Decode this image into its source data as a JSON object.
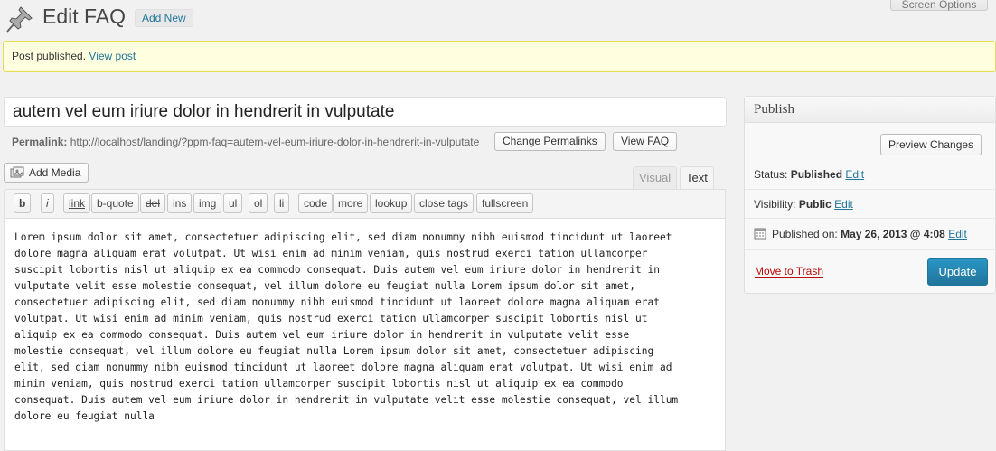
{
  "screen_options_label": "Screen Options",
  "header": {
    "title": "Edit FAQ",
    "add_new_label": "Add New"
  },
  "notice": {
    "text": "Post published.",
    "link": "View post"
  },
  "post": {
    "title": "autem vel eum iriure dolor in hendrerit in vulputate",
    "permalink_label": "Permalink:",
    "permalink_url": "http://localhost/landing/?ppm-faq=autem-vel-eum-iriure-dolor-in-hendrerit-in-vulputate",
    "change_permalinks_label": "Change Permalinks",
    "view_faq_label": "View FAQ"
  },
  "editor": {
    "add_media_label": "Add Media",
    "tabs": [
      "Visual",
      "Text"
    ],
    "active_tab": "Text",
    "quicktags": [
      "b",
      "i",
      "link",
      "b-quote",
      "del",
      "ins",
      "img",
      "ul",
      "ol",
      "li",
      "code",
      "more",
      "lookup",
      "close tags",
      "fullscreen"
    ],
    "lines": [
      "Lorem ipsum dolor sit amet, consectetuer adipiscing elit, sed diam nonummy nibh euismod tincidunt ut laoreet",
      "dolore magna aliquam erat volutpat. Ut wisi enim ad minim veniam, quis nostrud exerci tation ullamcorper",
      "suscipit lobortis nisl ut aliquip ex ea commodo consequat. Duis autem vel eum iriure dolor in hendrerit in",
      "vulputate velit esse molestie consequat, vel illum dolore eu feugiat nulla Lorem ipsum dolor sit amet,",
      "consectetuer adipiscing elit, sed diam nonummy nibh euismod tincidunt ut laoreet dolore magna aliquam erat",
      "volutpat. Ut wisi enim ad minim veniam, quis nostrud exerci tation ullamcorper suscipit lobortis nisl ut",
      "aliquip ex ea commodo consequat. Duis autem vel eum iriure dolor in hendrerit in vulputate velit esse",
      "molestie consequat, vel illum dolore eu feugiat nulla Lorem ipsum dolor sit amet, consectetuer adipiscing",
      "elit, sed diam nonummy nibh euismod tincidunt ut laoreet dolore magna aliquam erat volutpat. Ut wisi enim ad",
      "minim veniam, quis nostrud exerci tation ullamcorper suscipit lobortis nisl ut aliquip ex ea commodo",
      "consequat. Duis autem vel eum iriure dolor in hendrerit in vulputate velit esse molestie consequat, vel illum",
      "dolore eu feugiat nulla"
    ]
  },
  "publish": {
    "title": "Publish",
    "preview_label": "Preview Changes",
    "status_label": "Status:",
    "status_value": "Published",
    "visibility_label": "Visibility:",
    "visibility_value": "Public",
    "published_on_label": "Published on:",
    "published_on_value": "May 26, 2013 @ 4:08",
    "edit_label": "Edit",
    "trash_label": "Move to Trash",
    "update_label": "Update"
  },
  "colors": {
    "link": "#21759b",
    "notice_bg": "#ffffe0",
    "primary_button": "#21759b",
    "trash": "#bc0b0b"
  },
  "icons": [
    "pushpin-icon",
    "add-media-icon",
    "calendar-icon"
  ]
}
